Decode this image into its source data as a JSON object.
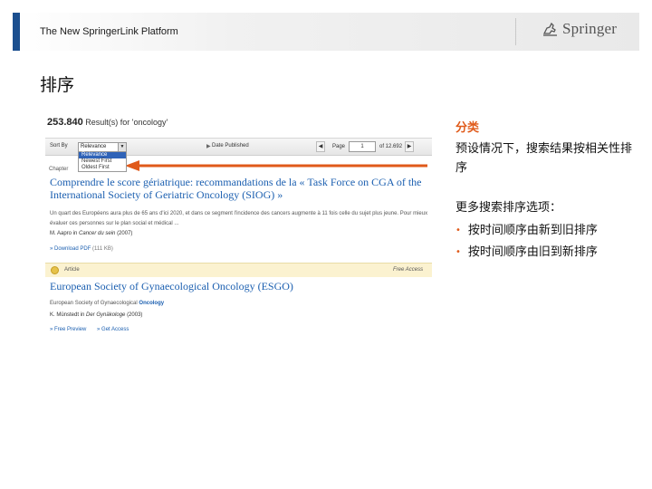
{
  "header": {
    "title": "The New SpringerLink Platform",
    "logo_text": "Springer"
  },
  "slide": {
    "heading": "排序"
  },
  "screenshot": {
    "result_count": "253.840",
    "result_text": "Result(s) for 'oncology'",
    "sort_by_label": "Sort By",
    "sort_selected": "Relevance",
    "sort_options": [
      "Relevance",
      "Newest First",
      "Oldest First"
    ],
    "date_published_label": "Date Published",
    "page_label": "Page",
    "page_value": "1",
    "page_of": "of 12.692",
    "chapter_label": "Chapter",
    "result1": {
      "title": "Comprendre le score gériatrique: recommandations de la « Task Force on CGA of the International Society of Geriatric Oncology (SIOG) »",
      "snippet": "Un quart des Européens aura plus de 65 ans d'ici 2020, et dans ce segment l'incidence des cancers augmente à 11 fois celle du sujet plus jeune. Pour mieux évaluer ces personnes sur le plan social et médical ...",
      "author": "M. Aapro in",
      "journal": "Cancer du sein",
      "year": "(2007)",
      "download_label": "» Download PDF",
      "download_size": "(111 KB)"
    },
    "result2": {
      "type": "Article",
      "access": "Free Access",
      "title": "European Society of Gynaecological Oncology (ESGO)",
      "org_prefix": "European Society of Gynaecological",
      "org_highlight": "Oncology",
      "author": "K. Münstedt in",
      "journal": "Der Gynäkologe",
      "year": "(2003)",
      "preview_label": "» Free Preview",
      "access_label": "» Get Access"
    }
  },
  "notes": {
    "category": "分类",
    "default_text": "预设情况下，搜索结果按相关性排序",
    "more_options": "更多搜索排序选项：",
    "options": [
      "按时间顺序由新到旧排序",
      "按时间顺序由旧到新排序"
    ]
  },
  "colors": {
    "accent": "#e05a1a",
    "link": "#1b5fb0",
    "brand_bar": "#1b4f8f"
  }
}
